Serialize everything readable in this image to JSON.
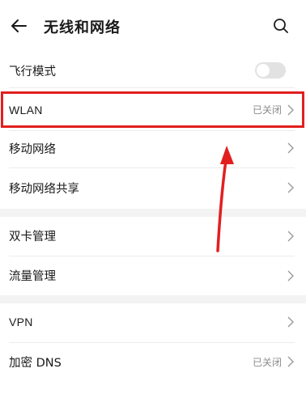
{
  "header": {
    "title": "无线和网络",
    "back_icon": "arrow-left-icon",
    "search_icon": "search-icon"
  },
  "settings": {
    "airplane_mode": {
      "label": "飞行模式",
      "toggle_on": false
    },
    "wlan": {
      "label": "WLAN",
      "status": "已关闭"
    },
    "mobile_network": {
      "label": "移动网络"
    },
    "hotspot": {
      "label": "移动网络共享"
    },
    "dual_sim": {
      "label": "双卡管理"
    },
    "data_usage": {
      "label": "流量管理"
    },
    "vpn": {
      "label": "VPN"
    },
    "private_dns": {
      "label": "加密 DNS",
      "status": "已关闭"
    }
  },
  "colors": {
    "highlight": "#e21f1f",
    "annotation_arrow": "#e21f1f",
    "status_text": "#8c8c8c",
    "section_gap": "#f3f3f3"
  }
}
